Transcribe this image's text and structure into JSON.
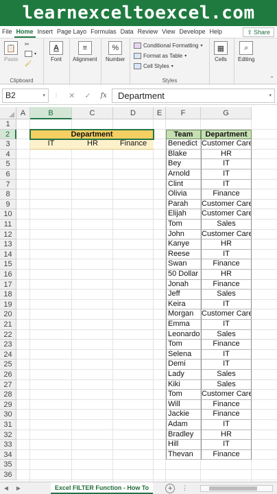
{
  "banner": {
    "text": "learnexceltoexcel.com"
  },
  "ribbon": {
    "tabs": [
      "File",
      "Home",
      "Insert",
      "Page Layo",
      "Formulas",
      "Data",
      "Review",
      "View",
      "Develope",
      "Help"
    ],
    "active_tab": "Home",
    "share_label": "Share",
    "groups": {
      "clipboard": {
        "label": "Clipboard",
        "paste": "Paste"
      },
      "font": {
        "label": "Font"
      },
      "alignment": {
        "label": "Alignment"
      },
      "number": {
        "label": "Number"
      },
      "styles": {
        "label": "Styles",
        "conditional_formatting": "Conditional Formatting",
        "format_as_table": "Format as Table",
        "cell_styles": "Cell Styles"
      },
      "cells": {
        "label": "Cells"
      },
      "editing": {
        "label": "Editing"
      }
    }
  },
  "formula_bar": {
    "name_box": "B2",
    "content": "Department",
    "cancel_symbol": "✕",
    "enter_symbol": "✓",
    "fx_symbol": "fx"
  },
  "columns": [
    "A",
    "B",
    "C",
    "D",
    "E",
    "F",
    "G"
  ],
  "selected_column": "B",
  "rows": [
    "1",
    "2",
    "3",
    "4",
    "5",
    "6",
    "7",
    "8",
    "9",
    "10",
    "11",
    "12",
    "13",
    "14",
    "15",
    "16",
    "17",
    "18",
    "19",
    "20",
    "21",
    "22",
    "23",
    "24",
    "25",
    "26",
    "27",
    "28",
    "29",
    "30",
    "31",
    "32",
    "33",
    "34",
    "35",
    "36"
  ],
  "selected_row": "2",
  "department_block": {
    "header": "Department",
    "values": [
      "IT",
      "HR",
      "Finance"
    ]
  },
  "team_table": {
    "headers": [
      "Team",
      "Department"
    ],
    "rows": [
      [
        "Benedict",
        "Customer Care"
      ],
      [
        "Blake",
        "HR"
      ],
      [
        "Bey",
        "IT"
      ],
      [
        "Arnold",
        "IT"
      ],
      [
        "Clint",
        "IT"
      ],
      [
        "Olivia",
        "Finance"
      ],
      [
        "Parah",
        "Customer Care"
      ],
      [
        "Elijah",
        "Customer Care"
      ],
      [
        "Tom",
        "Sales"
      ],
      [
        "John",
        "Customer Care"
      ],
      [
        "Kanye",
        "HR"
      ],
      [
        "Reese",
        "IT"
      ],
      [
        "Swan",
        "Finance"
      ],
      [
        "50 Dollar",
        "HR"
      ],
      [
        "Jonah",
        "Finance"
      ],
      [
        "Jeff",
        "Sales"
      ],
      [
        "Keira",
        "IT"
      ],
      [
        "Morgan",
        "Customer Care"
      ],
      [
        "Emma",
        "IT"
      ],
      [
        "Leonardo",
        "Sales"
      ],
      [
        "Tom",
        "Finance"
      ],
      [
        "Selena",
        "IT"
      ],
      [
        "Demi",
        "IT"
      ],
      [
        "Lady",
        "Sales"
      ],
      [
        "Kiki",
        "Sales"
      ],
      [
        "Tom",
        "Customer Care"
      ],
      [
        "Will",
        "Finance"
      ],
      [
        "Jackie",
        "Finance"
      ],
      [
        "Adam",
        "IT"
      ],
      [
        "Bradley",
        "HR"
      ],
      [
        "Hill",
        "IT"
      ],
      [
        "Thevan",
        "Finance"
      ]
    ]
  },
  "sheet_tabs": {
    "active": "Excel FILTER Function - How To"
  },
  "colors": {
    "excel_green": "#217346",
    "dept_header_fill": "#f6cf62",
    "dept_value_fill": "#fdf1cc",
    "team_header_fill": "#c6e0b4"
  }
}
